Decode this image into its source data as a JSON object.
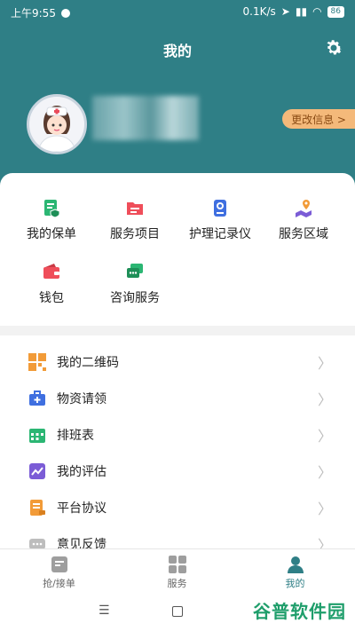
{
  "status_bar": {
    "time": "上午9:55",
    "speed": "0.1K/s",
    "battery": "86"
  },
  "header": {
    "title": "我的",
    "edit_label": "更改信息 >"
  },
  "grid": [
    {
      "label": "我的保单",
      "icon": "policy-icon",
      "color": "#2bb673"
    },
    {
      "label": "服务项目",
      "icon": "folder-icon",
      "color": "#ef4e5a"
    },
    {
      "label": "护理记录仪",
      "icon": "recorder-icon",
      "color": "#3f6fe0"
    },
    {
      "label": "服务区域",
      "icon": "location-icon",
      "color": "#7b5cd6"
    },
    {
      "label": "钱包",
      "icon": "wallet-icon",
      "color": "#ef4e5a"
    },
    {
      "label": "咨询服务",
      "icon": "chat-icon",
      "color": "#2bb673"
    }
  ],
  "menu": [
    {
      "label": "我的二维码",
      "icon": "qr-code-icon",
      "color": "#f29b38"
    },
    {
      "label": "物资请领",
      "icon": "medkit-icon",
      "color": "#3f6fe0"
    },
    {
      "label": "排班表",
      "icon": "calendar-icon",
      "color": "#2bb673"
    },
    {
      "label": "我的评估",
      "icon": "evaluation-icon",
      "color": "#7b5cd6"
    },
    {
      "label": "平台协议",
      "icon": "agreement-icon",
      "color": "#f29b38"
    },
    {
      "label": "意见反馈",
      "icon": "feedback-icon",
      "color": "#bdbdbd"
    }
  ],
  "tabs": [
    {
      "label": "抢/接单",
      "icon": "orders-icon",
      "active": false
    },
    {
      "label": "服务",
      "icon": "services-icon",
      "active": false
    },
    {
      "label": "我的",
      "icon": "profile-icon",
      "active": true
    }
  ],
  "watermark": "谷普软件园",
  "colors": {
    "header": "#2f7f86",
    "active_tab": "#2f7f86"
  }
}
